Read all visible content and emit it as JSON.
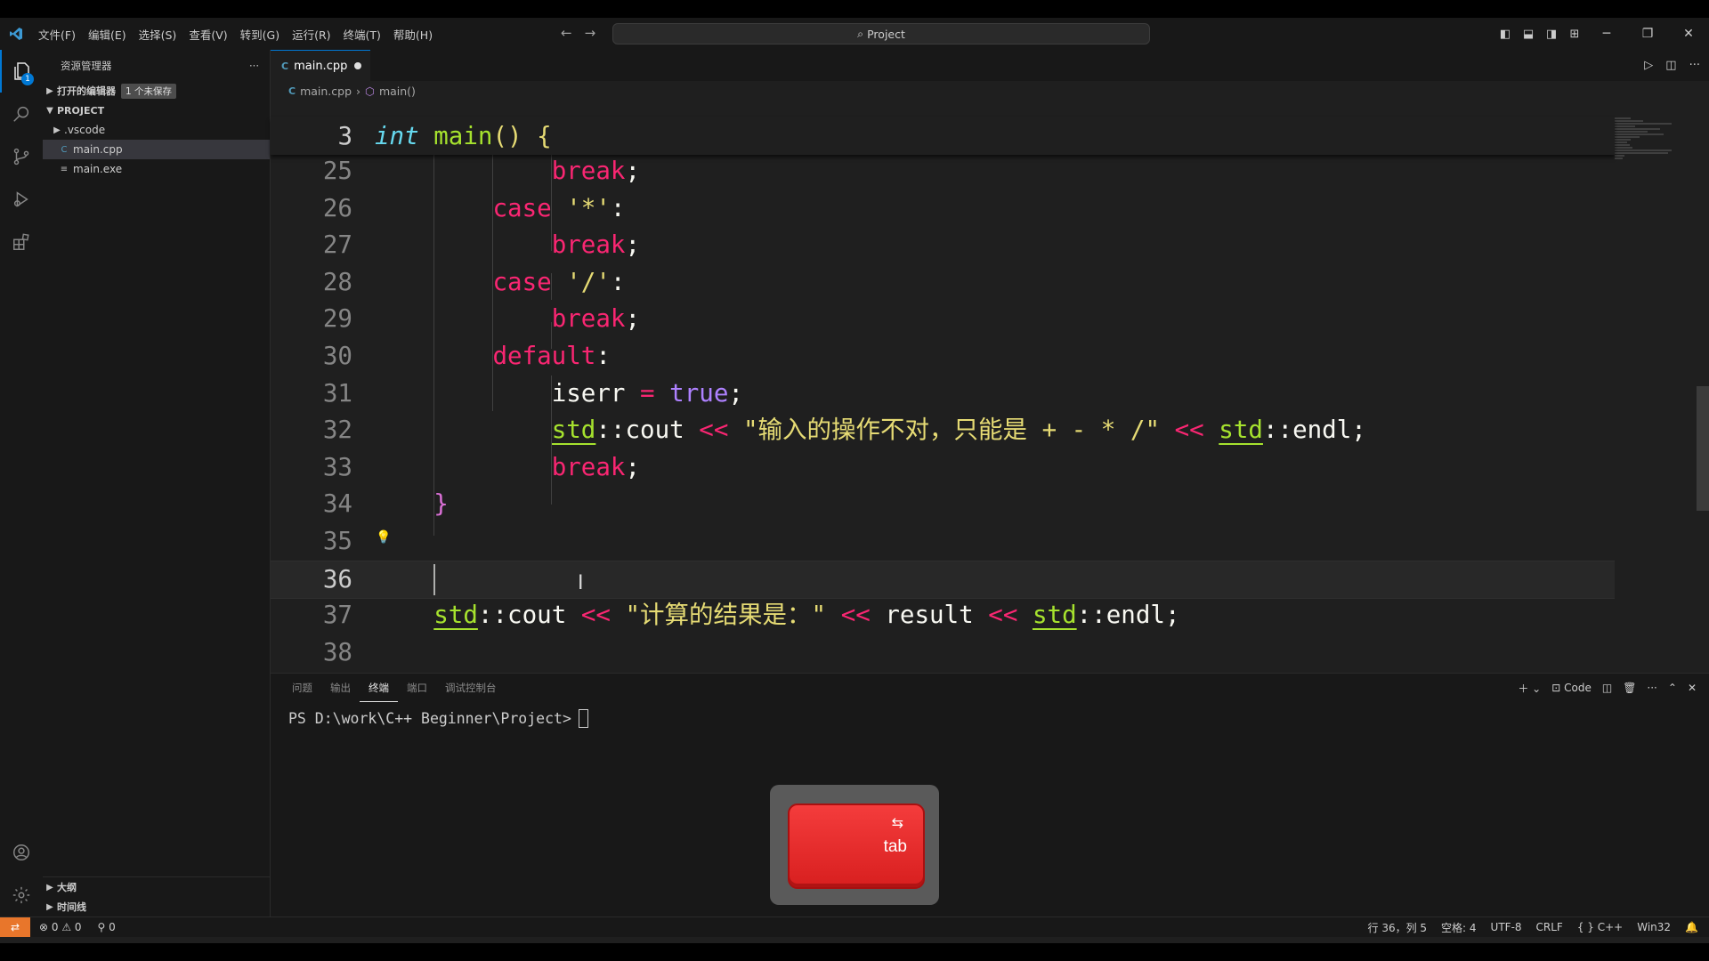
{
  "menu": [
    "文件(F)",
    "编辑(E)",
    "选择(S)",
    "查看(V)",
    "转到(G)",
    "运行(R)",
    "终端(T)",
    "帮助(H)"
  ],
  "command_center": {
    "text": "Project"
  },
  "activity_badge": "1",
  "sidebar": {
    "title": "资源管理器",
    "more": "···",
    "open_editors": "打开的编辑器",
    "unsaved": "1 个未保存",
    "project": "PROJECT",
    "items": [
      {
        "label": ".vscode",
        "type": "folder"
      },
      {
        "label": "main.cpp",
        "type": "cpp"
      },
      {
        "label": "main.exe",
        "type": "exe"
      }
    ],
    "outline": "大纲",
    "timeline": "时间线"
  },
  "tab": {
    "label": "main.cpp",
    "icon": "C"
  },
  "breadcrumb": {
    "file": "main.cpp",
    "symbol": "main()"
  },
  "sticky": {
    "num": "3",
    "kw": "int",
    "fn": "main",
    "rest": "() {"
  },
  "code_lines": [
    {
      "num": "25",
      "indent": "            ",
      "tokens": [
        [
          "kw",
          "break"
        ],
        [
          "pl",
          ";"
        ]
      ]
    },
    {
      "num": "26",
      "indent": "        ",
      "tokens": [
        [
          "kw",
          "case"
        ],
        [
          "pl",
          " "
        ],
        [
          "str",
          "'*'"
        ],
        [
          "pl",
          ":"
        ]
      ]
    },
    {
      "num": "27",
      "indent": "            ",
      "tokens": [
        [
          "kw",
          "break"
        ],
        [
          "pl",
          ";"
        ]
      ]
    },
    {
      "num": "28",
      "indent": "        ",
      "tokens": [
        [
          "kw",
          "case"
        ],
        [
          "pl",
          " "
        ],
        [
          "str",
          "'/'"
        ],
        [
          "pl",
          ":"
        ]
      ]
    },
    {
      "num": "29",
      "indent": "            ",
      "tokens": [
        [
          "kw",
          "break"
        ],
        [
          "pl",
          ";"
        ]
      ]
    },
    {
      "num": "30",
      "indent": "        ",
      "tokens": [
        [
          "kw",
          "default"
        ],
        [
          "pl",
          ":"
        ]
      ]
    },
    {
      "num": "31",
      "indent": "            ",
      "tokens": [
        [
          "pl",
          "iserr "
        ],
        [
          "op",
          "="
        ],
        [
          "pl",
          " "
        ],
        [
          "cst",
          "true"
        ],
        [
          "pl",
          ";"
        ]
      ]
    },
    {
      "num": "32",
      "indent": "            ",
      "tokens": [
        [
          "ns",
          "std"
        ],
        [
          "pl",
          "::cout "
        ],
        [
          "op",
          "<<"
        ],
        [
          "pl",
          " "
        ],
        [
          "str",
          "\"输入的操作不对，只能是 + - * /\""
        ],
        [
          "pl",
          " "
        ],
        [
          "op",
          "<<"
        ],
        [
          "pl",
          " "
        ],
        [
          "ns",
          "std"
        ],
        [
          "pl",
          "::endl;"
        ]
      ]
    },
    {
      "num": "33",
      "indent": "            ",
      "tokens": [
        [
          "kw",
          "break"
        ],
        [
          "pl",
          ";"
        ]
      ]
    },
    {
      "num": "34",
      "indent": "    ",
      "tokens": [
        [
          "brp",
          "}"
        ]
      ]
    },
    {
      "num": "35",
      "indent": "",
      "tokens": []
    },
    {
      "num": "36",
      "indent": "",
      "tokens": []
    },
    {
      "num": "37",
      "indent": "    ",
      "tokens": [
        [
          "ns",
          "std"
        ],
        [
          "pl",
          "::cout "
        ],
        [
          "op",
          "<<"
        ],
        [
          "pl",
          " "
        ],
        [
          "str",
          "\"计算的结果是：\""
        ],
        [
          "pl",
          " "
        ],
        [
          "op",
          "<<"
        ],
        [
          "pl",
          " result "
        ],
        [
          "op",
          "<<"
        ],
        [
          "pl",
          " "
        ],
        [
          "ns",
          "std"
        ],
        [
          "pl",
          "::endl;"
        ]
      ]
    },
    {
      "num": "38",
      "indent": "",
      "tokens": []
    }
  ],
  "panel": {
    "tabs": [
      "问题",
      "输出",
      "终端",
      "端口",
      "调试控制台"
    ],
    "active_tab": "终端",
    "shell": "Code",
    "prompt": "PS D:\\work\\C++ Beginner\\Project>"
  },
  "key_overlay": {
    "label": "tab",
    "icon": "⇆"
  },
  "status": {
    "errors": "0",
    "warnings": "0",
    "ports": "0",
    "position": "行 36，列 5",
    "spaces": "空格: 4",
    "encoding": "UTF-8",
    "eol": "CRLF",
    "language": "{ } C++",
    "platform": "Win32"
  },
  "colors": {
    "accent": "#0078d4",
    "remote": "#e8762b",
    "key": "#e02a2a"
  }
}
